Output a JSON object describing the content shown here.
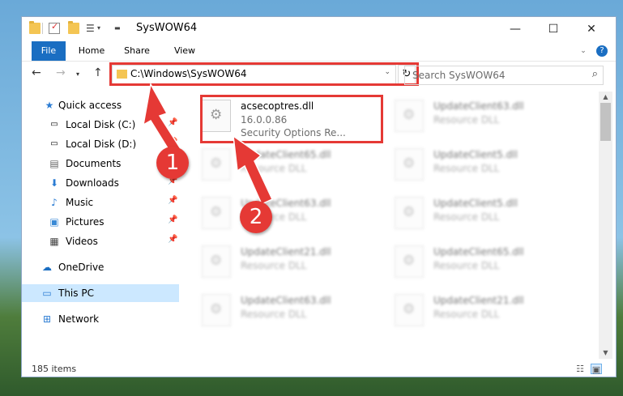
{
  "window": {
    "title": "SysWOW64",
    "controls": {
      "minimize": "—",
      "maximize": "☐",
      "close": "✕"
    }
  },
  "ribbon": {
    "tabs": [
      "File",
      "Home",
      "Share",
      "View"
    ],
    "help": "?"
  },
  "navigation": {
    "address": "C:\\Windows\\SysWOW64",
    "search_placeholder": "Search SysWOW64"
  },
  "sidebar": {
    "items": [
      {
        "label": "Quick access",
        "icon": "star-icon"
      },
      {
        "label": "Local Disk (C:)",
        "icon": "drive-icon",
        "pinned": true
      },
      {
        "label": "Local Disk (D:)",
        "icon": "drive-icon",
        "pinned": true
      },
      {
        "label": "Documents",
        "icon": "documents-icon",
        "pinned": true
      },
      {
        "label": "Downloads",
        "icon": "downloads-icon",
        "pinned": true
      },
      {
        "label": "Music",
        "icon": "music-icon",
        "pinned": true
      },
      {
        "label": "Pictures",
        "icon": "pictures-icon",
        "pinned": true
      },
      {
        "label": "Videos",
        "icon": "videos-icon",
        "pinned": true
      },
      {
        "label": "OneDrive",
        "icon": "cloud-icon"
      },
      {
        "label": "This PC",
        "icon": "pc-icon",
        "selected": true
      },
      {
        "label": "Network",
        "icon": "network-icon"
      }
    ]
  },
  "files": [
    {
      "name": "acsecoptres.dll",
      "version": "16.0.0.86",
      "description": "Security Options Re..."
    },
    {
      "name": "UpdateClient63.dll",
      "description": "Resource DLL"
    },
    {
      "name": "UpdateClient65.dll",
      "description": "Resource DLL"
    },
    {
      "name": "UpdateClient5.dll",
      "description": "Resource DLL"
    },
    {
      "name": "UpdateClient63.dll",
      "description": "Resource DLL"
    },
    {
      "name": "UpdateClient5.dll",
      "description": "Resource DLL"
    },
    {
      "name": "UpdateClient21.dll",
      "description": "Resource DLL"
    },
    {
      "name": "UpdateClient65.dll",
      "description": "Resource DLL"
    },
    {
      "name": "UpdateClient63.dll",
      "description": "Resource DLL"
    },
    {
      "name": "UpdateClient21.dll",
      "description": "Resource DLL"
    }
  ],
  "status": {
    "item_count": "185 items"
  },
  "annotations": {
    "step1": "1",
    "step2": "2",
    "highlight_color": "#e53935"
  }
}
